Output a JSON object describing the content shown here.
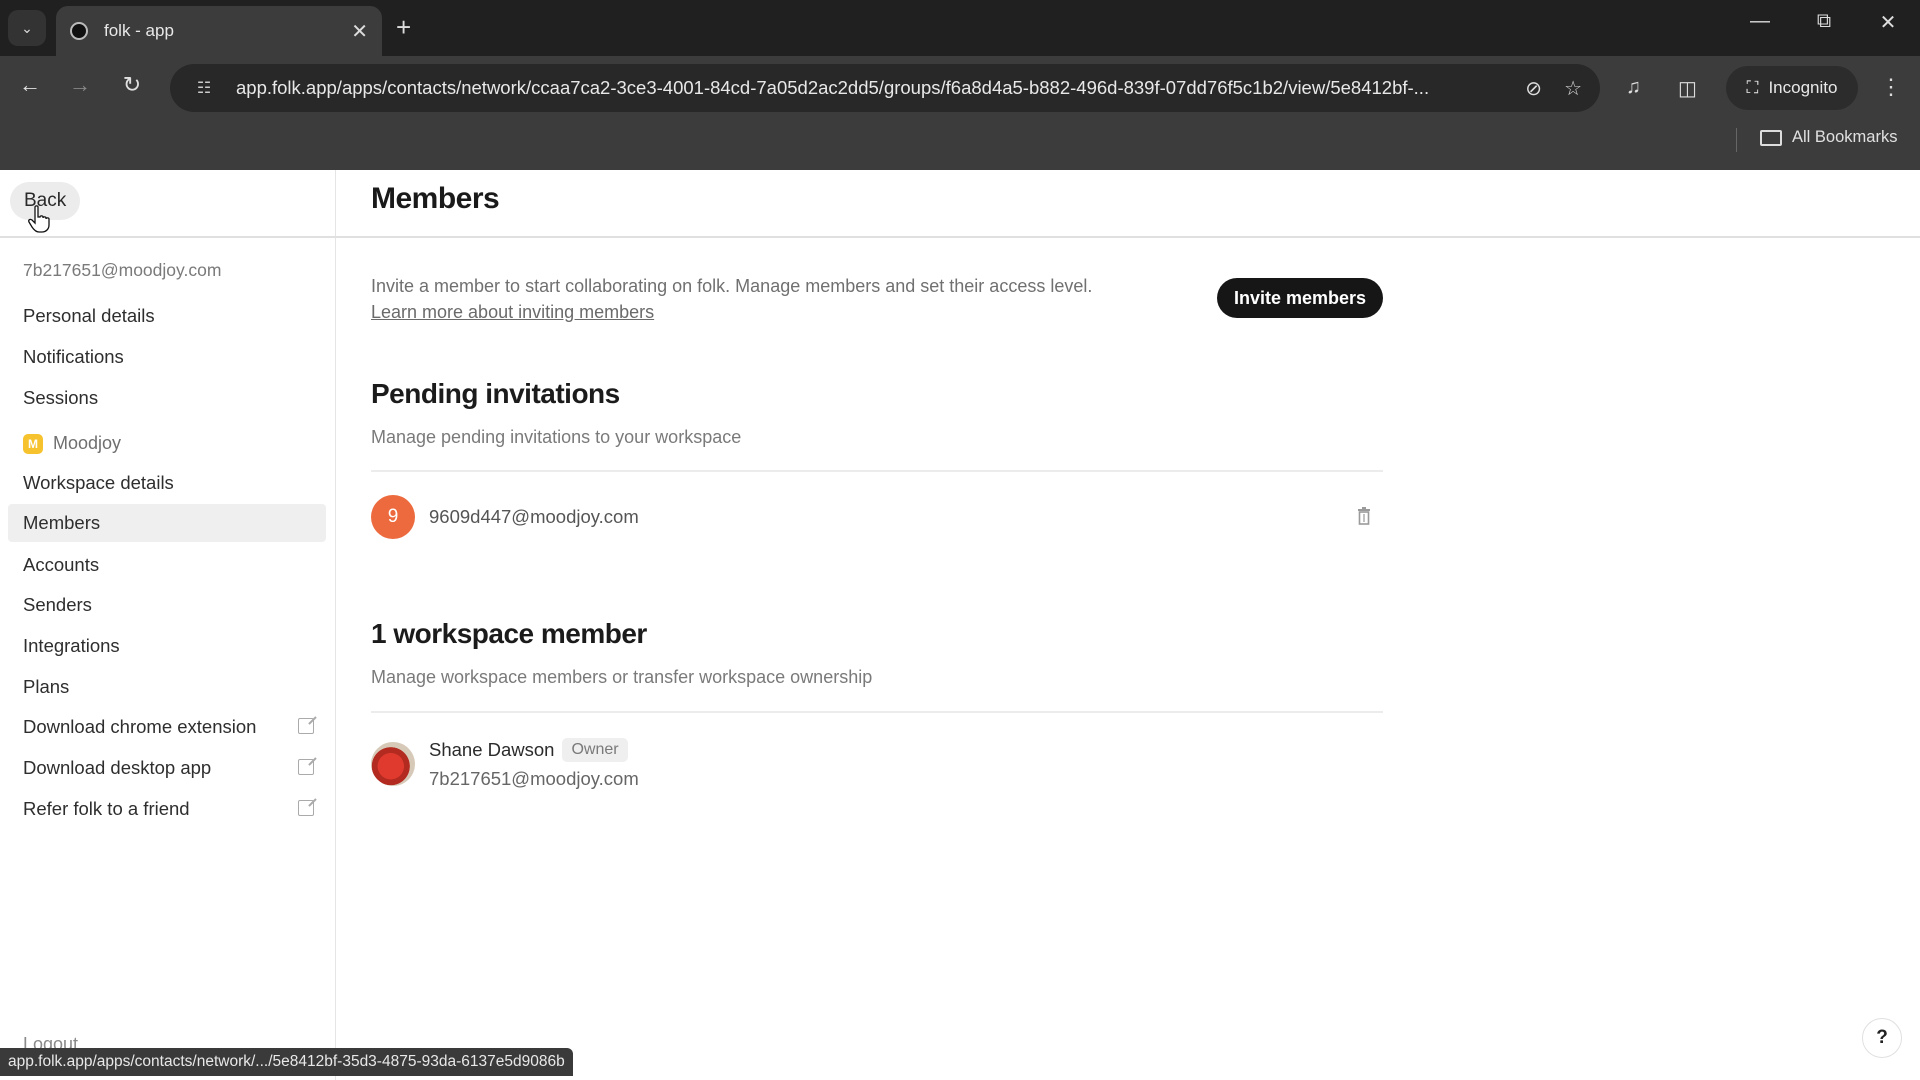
{
  "browser": {
    "tab_title": "folk - app",
    "url": "app.folk.app/apps/contacts/network/ccaa7ca2-3ce3-4001-84cd-7a05d2ac2dd5/groups/f6a8d4a5-b882-496d-839f-07dd76f5c1b2/view/5e8412bf-...",
    "incognito_label": "Incognito",
    "bookmarks_label": "All Bookmarks",
    "status_url": "app.folk.app/apps/contacts/network/.../5e8412bf-35d3-4875-93da-6137e5d9086b",
    "icons": {
      "tab_search": "chevron-down-icon",
      "close_tab": "close-icon",
      "new_tab": "plus-icon",
      "back": "arrow-left-icon",
      "forward": "arrow-right-icon",
      "reload": "reload-icon",
      "site_info": "tune-icon",
      "eye_off": "eye-off-icon",
      "bookmark": "star-icon",
      "media": "media-queue-icon",
      "side_panel": "side-panel-icon",
      "menu": "kebab-icon"
    }
  },
  "sidebar": {
    "back_label": "Back",
    "user_email": "7b217651@moodjoy.com",
    "account_items": [
      {
        "label": "Personal details"
      },
      {
        "label": "Notifications"
      },
      {
        "label": "Sessions"
      }
    ],
    "workspace": {
      "badge": "M",
      "name": "Moodjoy",
      "badge_color": "#f6c22d"
    },
    "workspace_items": [
      {
        "label": "Workspace details",
        "active": false
      },
      {
        "label": "Members",
        "active": true
      },
      {
        "label": "Accounts",
        "active": false
      },
      {
        "label": "Senders",
        "active": false
      },
      {
        "label": "Integrations",
        "active": false
      },
      {
        "label": "Plans",
        "active": false
      }
    ],
    "external_items": [
      {
        "label": "Download chrome extension"
      },
      {
        "label": "Download desktop app"
      },
      {
        "label": "Refer folk to a friend"
      }
    ],
    "logout_label": "Logout"
  },
  "main": {
    "title": "Members",
    "intro": "Invite a member to start collaborating on folk. Manage members and set their access level.",
    "learn_more": "Learn more about inviting members",
    "invite_button": "Invite members",
    "pending": {
      "title": "Pending invitations",
      "subtitle": "Manage pending invitations to your workspace",
      "items": [
        {
          "initial": "9",
          "email": "9609d447@moodjoy.com",
          "avatar_color": "#ec6a3d"
        }
      ]
    },
    "members": {
      "title": "1 workspace member",
      "subtitle": "Manage workspace members or transfer workspace ownership",
      "items": [
        {
          "name": "Shane Dawson",
          "role": "Owner",
          "email": "7b217651@moodjoy.com"
        }
      ]
    },
    "help_label": "?"
  }
}
